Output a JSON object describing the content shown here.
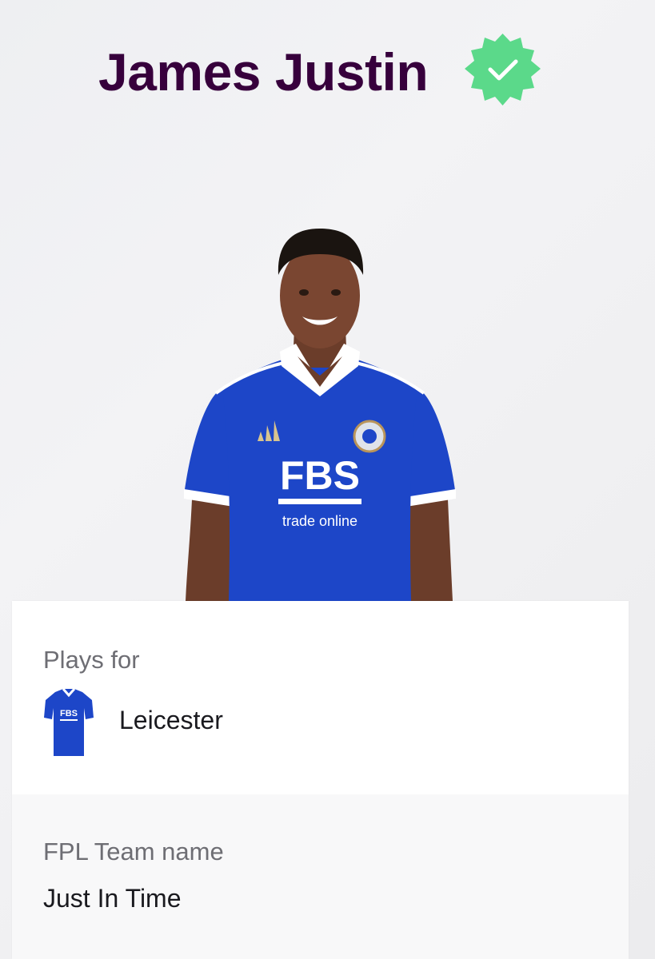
{
  "player": {
    "name": "James Justin",
    "verified_icon": "verified-check-badge-icon",
    "photo": "player-portrait",
    "shirt_sponsor": "FBS",
    "shirt_sponsor_sub": "trade online"
  },
  "plays_for": {
    "label": "Plays for",
    "club": "Leicester",
    "shirt_icon": "leicester-shirt-icon",
    "shirt_text": "FBS"
  },
  "fpl_team": {
    "label": "FPL Team name",
    "value": "Just In Time"
  },
  "colors": {
    "title": "#37003c",
    "verified": "#5bd98a",
    "shirt_blue": "#1d46c8",
    "label_grey": "#6e6e74"
  }
}
